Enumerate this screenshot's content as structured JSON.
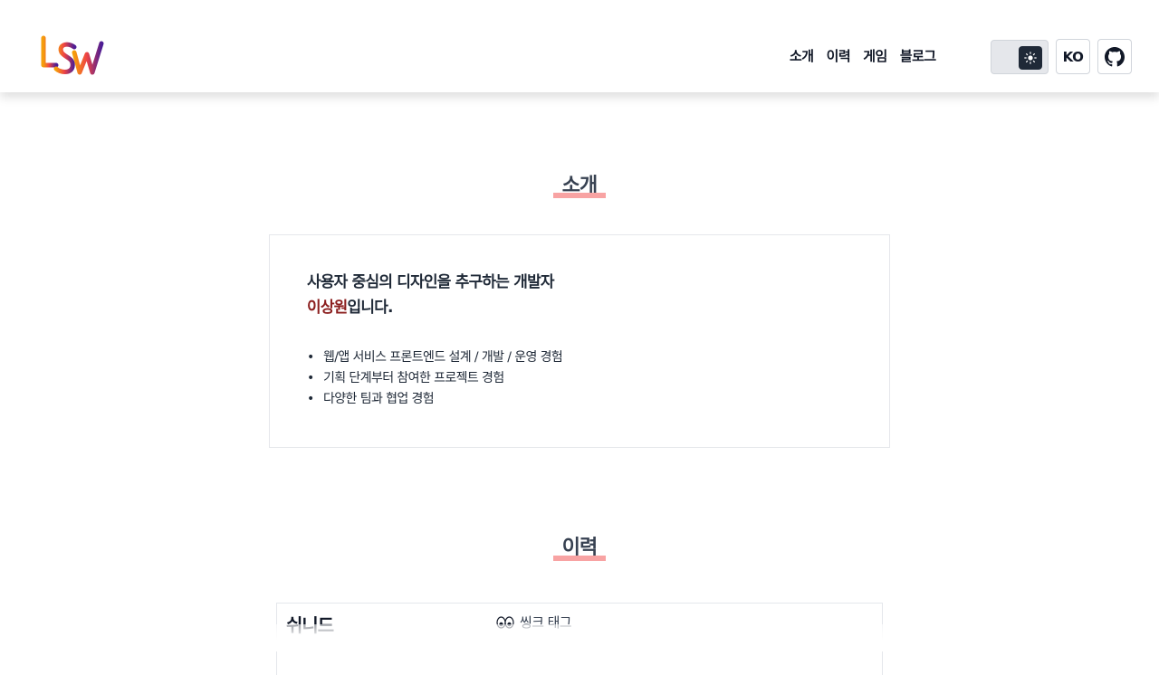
{
  "header": {
    "logo_text": "LSW",
    "nav": [
      {
        "label": "소개"
      },
      {
        "label": "이력"
      },
      {
        "label": "게임"
      },
      {
        "label": "블로그"
      }
    ],
    "theme_toggle": {
      "icon": "sun-icon",
      "state": "light"
    },
    "language_label": "KO",
    "github_icon": "github-icon"
  },
  "about": {
    "title": "소개",
    "headline_line1": "사용자 중심의 디자인을 추구하는 개발자",
    "name": "이상원",
    "headline_suffix": "입니다.",
    "bullets": [
      "웹/앱 서비스 프론트엔드 설계 / 개발 / 운영 경험",
      "기획 단계부터 참여한 프로젝트 경험",
      "다양한 팀과 협업 경험"
    ]
  },
  "history": {
    "title": "이력",
    "rows": [
      {
        "left": "쉬니드",
        "right_icon": "eyes-icon",
        "right": "씽크 태그"
      }
    ]
  },
  "colors": {
    "accent_underline": "#f8a3a3",
    "name_highlight": "#8b1e1e",
    "toggle_knob": "#1f2937"
  }
}
